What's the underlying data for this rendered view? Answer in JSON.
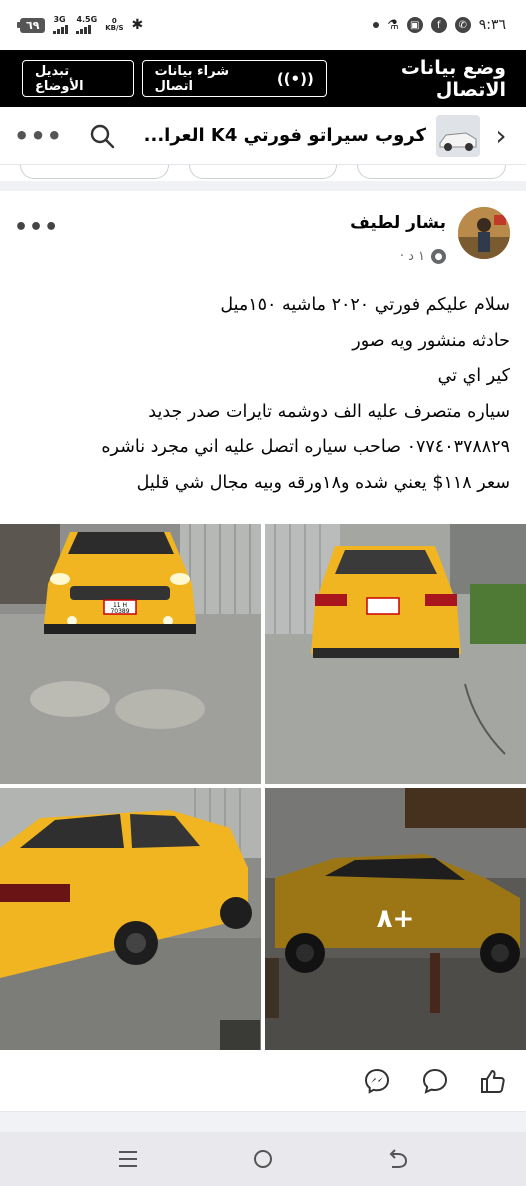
{
  "status_bar": {
    "time": "٩:٣٦",
    "battery": "٦٩",
    "network_1": "3G",
    "network_2": "4.5G",
    "speed_unit": "KB/S"
  },
  "data_bar": {
    "title": "وضع بيانات الاتصال",
    "buy_data_label": "شراء بيانات اتصال",
    "switch_mode_label": "تبديل الأوضاع"
  },
  "header": {
    "group_title": "كروب سيراتو فورتي K4 العرا..."
  },
  "post": {
    "author": "بشار لطيف",
    "time": "١ د ·",
    "lines": [
      "سلام عليكم فورتي ٢٠٢٠ ماشيه ١٥٠ميل",
      "حادثه منشور ويه صور",
      "كير اي تي",
      "سياره متصرف عليه الف دوشمه تايرات صدر جديد",
      "٠٧٧٤٠٣٧٨٨٢٩ صاحب سياره اتصل عليه اني مجرد ناشره",
      "سعر ١١٨$ يعني شده و١٨ورقه وبيه مجال شي قليل"
    ],
    "more_photos": "٨+",
    "plate_text": "11 H",
    "plate_number": "70389"
  },
  "icons": {
    "back": "chevron-left-icon",
    "search": "search-icon",
    "more": "more-dots-icon",
    "messenger": "messenger-icon",
    "comment": "comment-icon",
    "like": "like-icon"
  }
}
